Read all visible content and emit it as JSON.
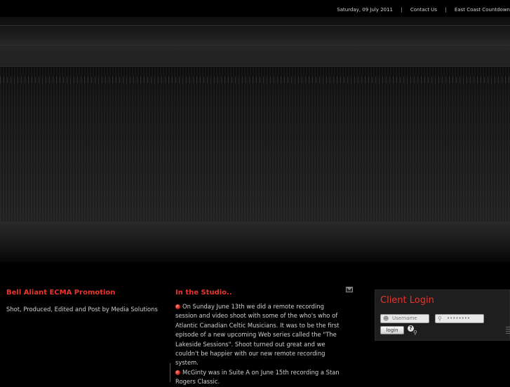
{
  "topbar": {
    "date": "Saturday, 09 July 2011",
    "contact": "Contact Us",
    "countdown": "East Coast Countdown",
    "separator": "|"
  },
  "col1": {
    "heading": "Bell Aliant ECMA Promotion",
    "text": "Shot, Produced, Edited and Post by Media Solutions"
  },
  "col2": {
    "heading": "In the Studio..",
    "items": [
      "On Sunday June 13th we did a remote recording session and video shoot with some of the who's who of Atlantic Canadian Celtic Musicians. It was to be the first episode of a new upcoming Web series called the \"The Lakeside Sessions\". Shoot turned out great and we couldn't be happier with our new remote recording system.",
      "McGinty was in Suite A on June 15th recording a Stan Rogers Classic."
    ]
  },
  "login": {
    "title": "Client Login",
    "username_placeholder": "Username",
    "password_value": "••••••••",
    "button": "login",
    "help": "?"
  },
  "colors": {
    "accent": "#e8352e",
    "background": "#000000"
  },
  "icons": [
    "mail-icon",
    "user-icon",
    "lock-icon",
    "help-icon",
    "key-icon"
  ]
}
